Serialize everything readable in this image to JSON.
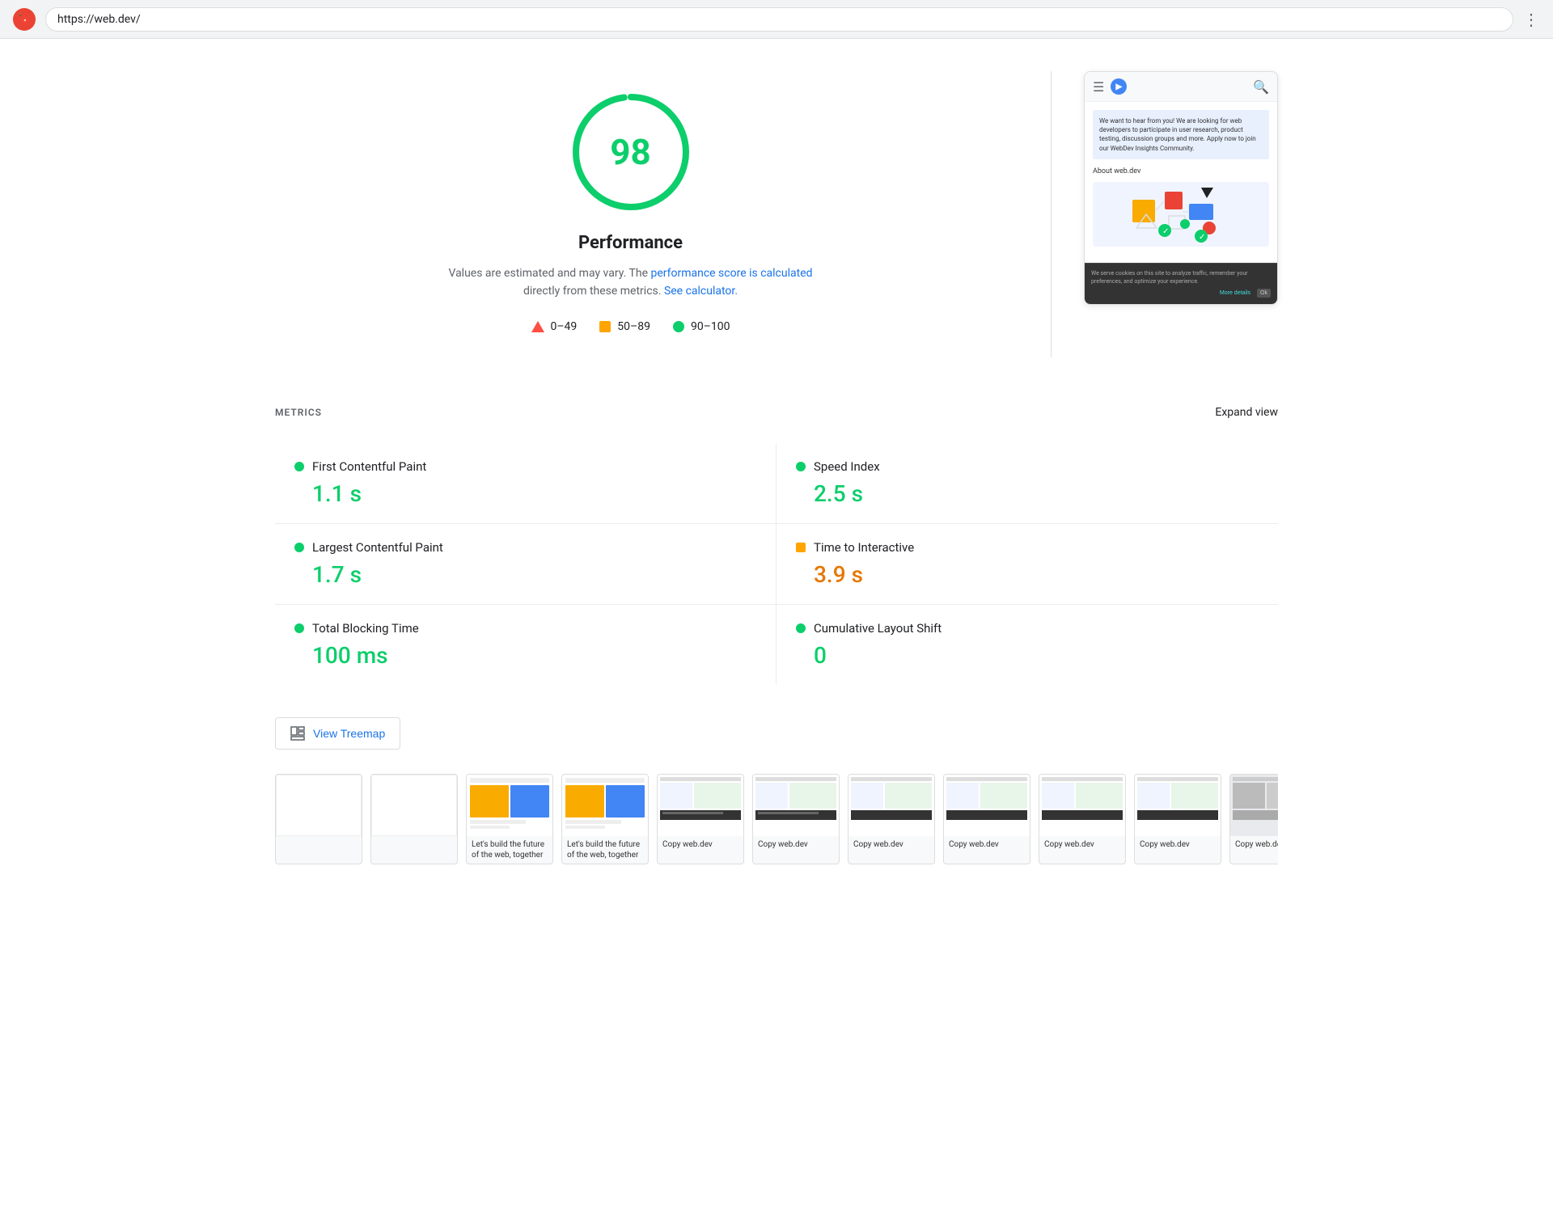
{
  "browser": {
    "url": "https://web.dev/",
    "menu_icon": "⋮"
  },
  "score_section": {
    "score": "98",
    "title": "Performance",
    "description_plain": "Values are estimated and may vary. The ",
    "description_link1": "performance score is calculated",
    "description_mid": " directly from these metrics. ",
    "description_link2": "See calculator.",
    "legend": {
      "item1_range": "0–49",
      "item2_range": "50–89",
      "item3_range": "90–100"
    }
  },
  "preview": {
    "banner_text": "We want to hear from you! We are looking for web developers to participate in user research, product testing, discussion groups and more. Apply now to join our WebDev Insights Community.",
    "about_text": "About web.dev",
    "cookie_text": "We serve cookies on this site to analyze traffic, remember your preferences, and optimize your experience.",
    "more_details": "More details",
    "ok_label": "Ok"
  },
  "metrics": {
    "section_label": "METRICS",
    "expand_label": "Expand view",
    "items": [
      {
        "name": "First Contentful Paint",
        "value": "1.1 s",
        "status": "green",
        "dot_shape": "circle"
      },
      {
        "name": "Speed Index",
        "value": "2.5 s",
        "status": "green",
        "dot_shape": "circle"
      },
      {
        "name": "Largest Contentful Paint",
        "value": "1.7 s",
        "status": "green",
        "dot_shape": "circle"
      },
      {
        "name": "Time to Interactive",
        "value": "3.9 s",
        "status": "orange",
        "dot_shape": "square"
      },
      {
        "name": "Total Blocking Time",
        "value": "100 ms",
        "status": "green",
        "dot_shape": "circle"
      },
      {
        "name": "Cumulative Layout Shift",
        "value": "0",
        "status": "green",
        "dot_shape": "circle"
      }
    ]
  },
  "treemap": {
    "button_label": "View Treemap"
  },
  "filmstrip": {
    "frames": [
      {
        "caption": ""
      },
      {
        "caption": ""
      },
      {
        "caption": "Let's build the future of the web, together"
      },
      {
        "caption": "Let's build the future of the web, together"
      },
      {
        "caption": "Copy web.dev"
      },
      {
        "caption": "Copy web.dev"
      },
      {
        "caption": "Copy web.dev"
      },
      {
        "caption": "Copy web.dev"
      },
      {
        "caption": "Copy web.dev"
      },
      {
        "caption": "Copy web.dev"
      },
      {
        "caption": "Copy web.dev"
      }
    ]
  }
}
